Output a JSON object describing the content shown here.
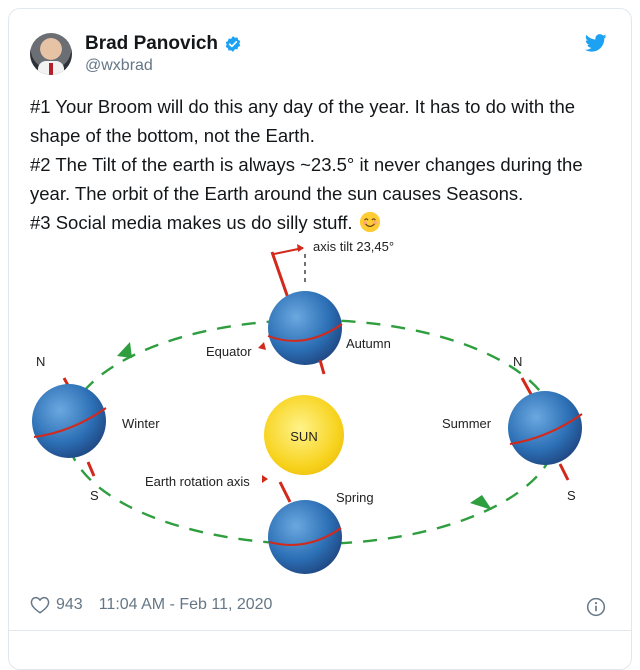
{
  "author": {
    "name": "Brad Panovich",
    "handle": "@wxbrad"
  },
  "tweet": {
    "lines": [
      "#1 Your Broom will do this any day of the year. It has to do with the",
      "shape of the bottom, not the Earth.",
      "#2 The Tilt of the earth is always ~23.5° it never changes during the",
      "year. The orbit of the Earth around the sun causes Seasons.",
      "#3 Social media makes us do silly stuff."
    ]
  },
  "diagram": {
    "axis_tilt": "axis tilt 23,45°",
    "equator": "Equator",
    "autumn": "Autumn",
    "winter": "Winter",
    "summer": "Summer",
    "spring": "Spring",
    "sun": "SUN",
    "rotation_axis": "Earth rotation axis",
    "north_left": "N",
    "south_left": "S",
    "north_right": "N",
    "south_right": "S"
  },
  "footer": {
    "likes": "943",
    "timestamp": "11:04 AM - Feb 11, 2020"
  },
  "colors": {
    "verified": "#1da1f2",
    "earth": "#2c6fb5",
    "sun": "#f7d21c",
    "orbit": "#2e9e3e",
    "tilt": "#d12a1c"
  },
  "icons": [
    "avatar",
    "verified-icon",
    "twitter-bird-icon",
    "smile-emoji-icon",
    "heart-icon",
    "info-icon"
  ]
}
